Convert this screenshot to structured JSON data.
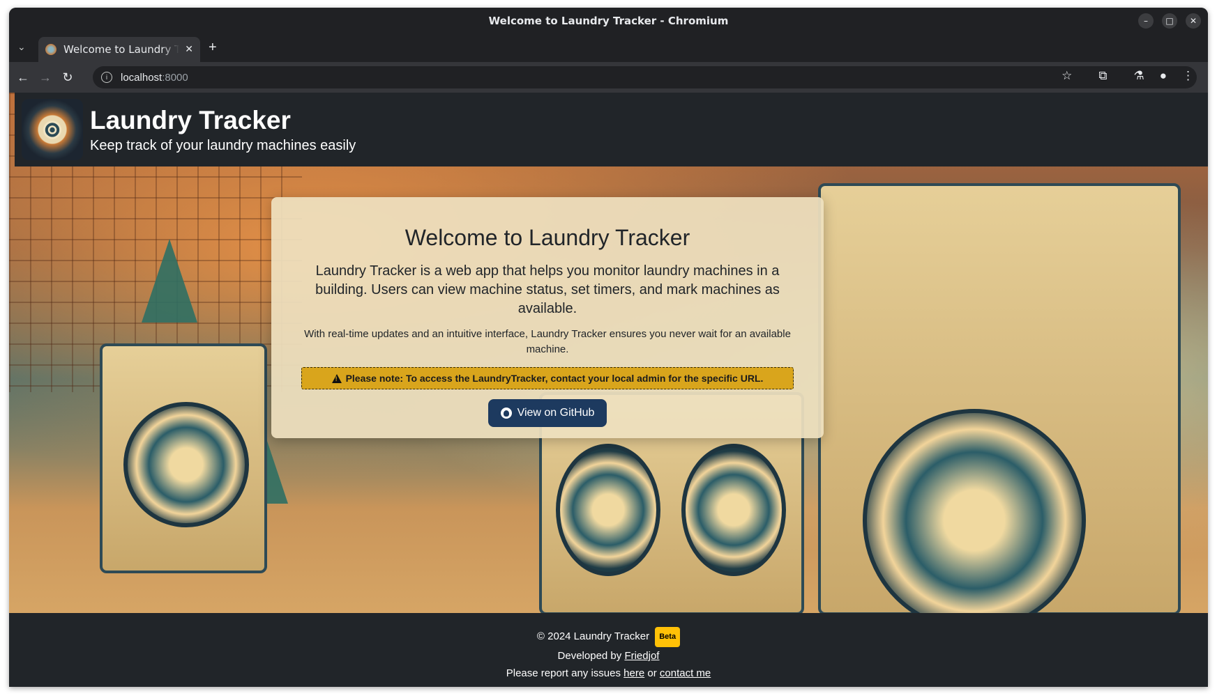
{
  "window": {
    "title": "Welcome to Laundry Tracker - Chromium"
  },
  "tabs": [
    {
      "title": "Welcome to Laundry Tracker",
      "active": true
    }
  ],
  "address_bar": {
    "host": "localhost",
    "port": ":8000"
  },
  "header": {
    "title": "Laundry Tracker",
    "subtitle": "Keep track of your laundry machines easily"
  },
  "card": {
    "heading": "Welcome to Laundry Tracker",
    "lead": "Laundry Tracker is a web app that helps you monitor laundry machines in a building. Users can view machine status, set timers, and mark machines as available.",
    "body": "With real-time updates and an intuitive interface, Laundry Tracker ensures you never wait for an available machine.",
    "alert": "Please note: To access the LaundryTracker, contact your local admin for the specific URL.",
    "github_button": "View on GitHub"
  },
  "footer": {
    "copyright": "© 2024 Laundry Tracker",
    "badge": "Beta",
    "developed_by": "Developed by",
    "developer": "Friedjof",
    "report_prefix": "Please report any issues",
    "here": "here",
    "or": "or",
    "contact": "contact me"
  },
  "colors": {
    "header_bg": "#212529",
    "alert_bg": "#d9a51c",
    "button_bg": "#1d3a5f",
    "badge_bg": "#ffc107"
  }
}
